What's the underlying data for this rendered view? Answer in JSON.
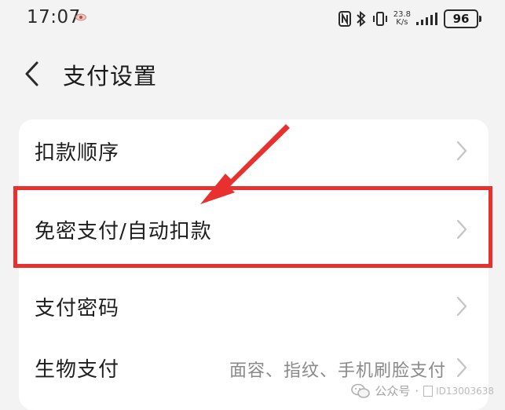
{
  "status_bar": {
    "time": "17:07",
    "speed_value": "23.8",
    "speed_unit": "K/s",
    "battery": "96"
  },
  "header": {
    "title": "支付设置"
  },
  "settings": {
    "rows": [
      {
        "label": "扣款顺序",
        "value": ""
      },
      {
        "label": "免密支付/自动扣款",
        "value": ""
      },
      {
        "label": "支付密码",
        "value": ""
      },
      {
        "label": "生物支付",
        "value": "面容、指纹、手机刷脸支付"
      }
    ]
  },
  "annotation": {
    "highlight_color": "#e8302f"
  },
  "watermark": {
    "source": "公众号",
    "separator": "·",
    "id_text": "ID13003638"
  },
  "icons": [
    "eye-icon",
    "nfc-icon",
    "bluetooth-icon",
    "vibrate-icon",
    "signal-icon",
    "battery-icon",
    "back-icon",
    "chevron-right-icon",
    "wechat-icon"
  ]
}
